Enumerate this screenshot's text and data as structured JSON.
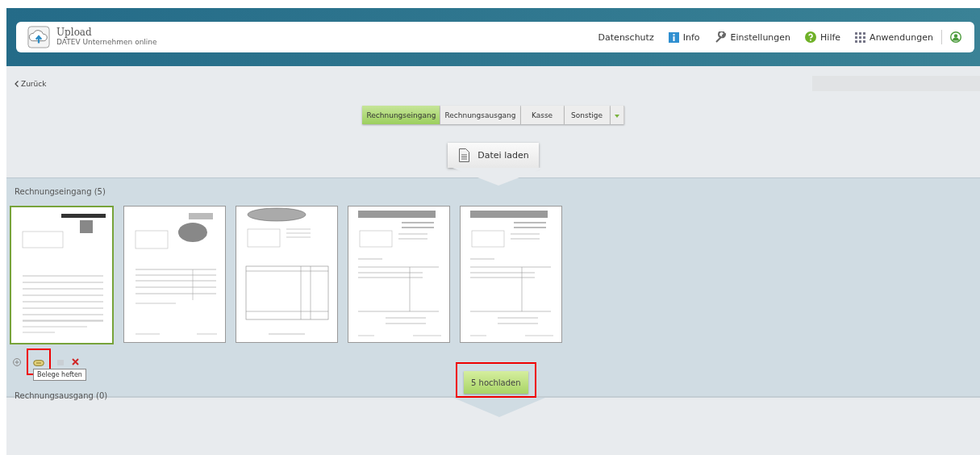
{
  "header": {
    "title": "Upload",
    "subtitle": "DATEV Unternehmen online",
    "nav": [
      {
        "label": "Datenschutz"
      },
      {
        "label": "Info"
      },
      {
        "label": "Einstellungen"
      },
      {
        "label": "Hilfe"
      },
      {
        "label": "Anwendungen"
      }
    ]
  },
  "back": "Zurück",
  "categories": [
    {
      "label": "Rechnungseingang",
      "selected": true
    },
    {
      "label": "Rechnungsausgang",
      "selected": false
    },
    {
      "label": "Kasse",
      "selected": false
    },
    {
      "label": "Sonstige",
      "selected": false
    }
  ],
  "file_button": "Datei laden",
  "sections": [
    {
      "title": "Rechnungseingang (5)"
    },
    {
      "title": "Rechnungsausgang (0)"
    }
  ],
  "documents": [
    {
      "kind": "colored",
      "selected": true
    },
    {
      "kind": "logo",
      "selected": false
    },
    {
      "kind": "oval",
      "selected": false
    },
    {
      "kind": "banner",
      "selected": false
    },
    {
      "kind": "banner",
      "selected": false
    }
  ],
  "tooltip": "Belege heften",
  "upload_button": "5 hochladen"
}
